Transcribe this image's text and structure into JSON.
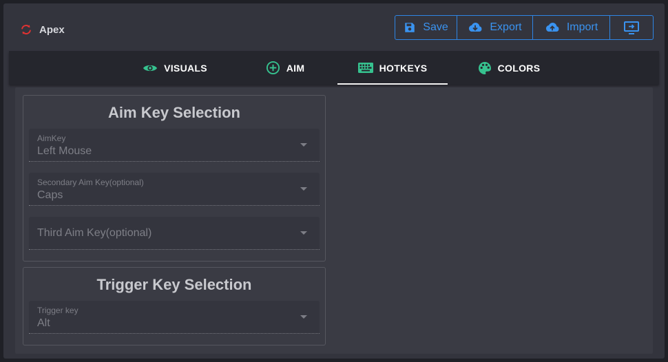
{
  "app": {
    "name": "Apex",
    "logo_color": "#e03232"
  },
  "toolbar": {
    "save_label": "Save",
    "export_label": "Export",
    "import_label": "Import",
    "accent": "#2e86e6"
  },
  "tabs": [
    {
      "label": "VISUALS",
      "icon": "eye-icon",
      "active": false
    },
    {
      "label": "AIM",
      "icon": "plus-circle-icon",
      "active": false
    },
    {
      "label": "HOTKEYS",
      "icon": "keyboard-icon",
      "active": true
    },
    {
      "label": "COLORS",
      "icon": "palette-icon",
      "active": false
    }
  ],
  "tab_icon_color": "#36c28f",
  "aim_section": {
    "title": "Aim Key Selection",
    "fields": [
      {
        "label": "AimKey",
        "value": "Left Mouse"
      },
      {
        "label": "Secondary Aim Key(optional)",
        "value": "Caps"
      },
      {
        "placeholder": "Third Aim Key(optional)",
        "value": ""
      }
    ]
  },
  "trigger_section": {
    "title": "Trigger Key Selection",
    "fields": [
      {
        "label": "Trigger key",
        "value": "Alt"
      }
    ]
  }
}
